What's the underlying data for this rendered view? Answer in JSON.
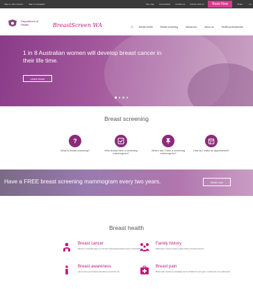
{
  "utility_bar": {
    "skip_content": "Skip to main content",
    "skip_nav": "Skip to navigation",
    "links": [
      "Site map",
      "Accessibility",
      "Contact us",
      "Partner with us"
    ],
    "book_now": "Book Now",
    "share": "Share",
    "font_size": "A+"
  },
  "header": {
    "dept_line1": "Department of",
    "dept_line2": "Health",
    "logo": "BreastScreen WA",
    "nav": [
      "Breast health",
      "Breast screening",
      "Newsroom",
      "About us",
      "Health professionals"
    ]
  },
  "hero": {
    "headline": "1 in 8 Australian women will develop breast cancer in their life time.",
    "button": "Learn more",
    "slides": 4,
    "active_slide": 1
  },
  "screening": {
    "title": "Breast screening",
    "items": [
      {
        "icon": "question-icon",
        "label": "What is breast screening?"
      },
      {
        "icon": "check-icon",
        "label": "Who should have a screening mammogram?"
      },
      {
        "icon": "pin-icon",
        "label": "Where can I have a screening mammogram?"
      },
      {
        "icon": "calendar-icon",
        "label": "How do I make an appointment?"
      }
    ]
  },
  "banner": {
    "text": "Have a FREE breast screening mammogram every two years.",
    "button": "Book now"
  },
  "health": {
    "title": "Breast health",
    "items": [
      {
        "icon": "people-icon",
        "title": "Breast cancer",
        "desc": "Women in Australia have a 1 in 8 risk of developing breast cancer in their lifetime."
      },
      {
        "icon": "family-icon",
        "title": "Family history",
        "desc": "What does it mean to have a family history of breast cancer?"
      },
      {
        "icon": "awareness-icon",
        "title": "Breast awareness",
        "desc": "Get to know your breasts and what is normal for you."
      },
      {
        "icon": "first-aid-icon",
        "title": "Breast pain",
        "desc": "Breast pain (known as mastalgia) can be divided into two types: cyclical and non-cyclical pain."
      }
    ]
  },
  "colors": {
    "accent": "#c2187a",
    "icon_purple": "#8b2a7a",
    "book_button": "#d93a8f"
  }
}
